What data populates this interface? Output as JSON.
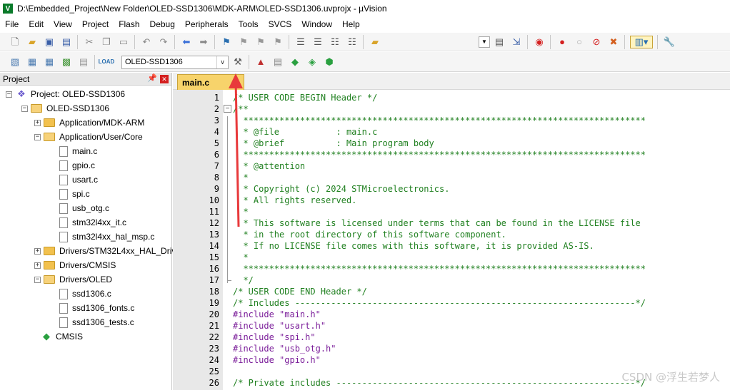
{
  "window": {
    "title": "D:\\Embedded_Project\\New Folder\\OLED-SSD1306\\MDK-ARM\\OLED-SSD1306.uvprojx - µVision",
    "app_icon_letter": "V"
  },
  "menu": [
    "File",
    "Edit",
    "View",
    "Project",
    "Flash",
    "Debug",
    "Peripherals",
    "Tools",
    "SVCS",
    "Window",
    "Help"
  ],
  "toolbar": {
    "target_select_value": "OLED-SSD1306"
  },
  "project_pane": {
    "title": "Project",
    "tree": [
      {
        "label": "Project: OLED-SSD1306",
        "level": 0,
        "toggle": "−",
        "kind": "project"
      },
      {
        "label": "OLED-SSD1306",
        "level": 1,
        "toggle": "−",
        "kind": "folder-open"
      },
      {
        "label": "Application/MDK-ARM",
        "level": 2,
        "toggle": "+",
        "kind": "folder"
      },
      {
        "label": "Application/User/Core",
        "level": 2,
        "toggle": "−",
        "kind": "folder-open"
      },
      {
        "label": "main.c",
        "level": 3,
        "toggle": "",
        "kind": "file"
      },
      {
        "label": "gpio.c",
        "level": 3,
        "toggle": "",
        "kind": "file"
      },
      {
        "label": "usart.c",
        "level": 3,
        "toggle": "",
        "kind": "file"
      },
      {
        "label": "spi.c",
        "level": 3,
        "toggle": "",
        "kind": "file"
      },
      {
        "label": "usb_otg.c",
        "level": 3,
        "toggle": "",
        "kind": "file"
      },
      {
        "label": "stm32l4xx_it.c",
        "level": 3,
        "toggle": "",
        "kind": "file"
      },
      {
        "label": "stm32l4xx_hal_msp.c",
        "level": 3,
        "toggle": "",
        "kind": "file"
      },
      {
        "label": "Drivers/STM32L4xx_HAL_Driv",
        "level": 2,
        "toggle": "+",
        "kind": "folder"
      },
      {
        "label": "Drivers/CMSIS",
        "level": 2,
        "toggle": "+",
        "kind": "folder"
      },
      {
        "label": "Drivers/OLED",
        "level": 2,
        "toggle": "−",
        "kind": "folder-open"
      },
      {
        "label": "ssd1306.c",
        "level": 3,
        "toggle": "",
        "kind": "file"
      },
      {
        "label": "ssd1306_fonts.c",
        "level": 3,
        "toggle": "",
        "kind": "file"
      },
      {
        "label": "ssd1306_tests.c",
        "level": 3,
        "toggle": "",
        "kind": "file"
      },
      {
        "label": "CMSIS",
        "level": 2,
        "toggle": "",
        "kind": "gem"
      }
    ]
  },
  "editor": {
    "active_tab": "main.c",
    "lines": [
      {
        "n": "1",
        "text": "/* USER CODE BEGIN Header */"
      },
      {
        "n": "2",
        "text": "/**"
      },
      {
        "n": "3",
        "text": "  ******************************************************************************"
      },
      {
        "n": "4",
        "text": "  * @file           : main.c"
      },
      {
        "n": "5",
        "text": "  * @brief          : Main program body"
      },
      {
        "n": "6",
        "text": "  ******************************************************************************"
      },
      {
        "n": "7",
        "text": "  * @attention"
      },
      {
        "n": "8",
        "text": "  *"
      },
      {
        "n": "9",
        "text": "  * Copyright (c) 2024 STMicroelectronics."
      },
      {
        "n": "10",
        "text": "  * All rights reserved."
      },
      {
        "n": "11",
        "text": "  *"
      },
      {
        "n": "12",
        "text": "  * This software is licensed under terms that can be found in the LICENSE file"
      },
      {
        "n": "13",
        "text": "  * in the root directory of this software component."
      },
      {
        "n": "14",
        "text": "  * If no LICENSE file comes with this software, it is provided AS-IS."
      },
      {
        "n": "15",
        "text": "  *"
      },
      {
        "n": "16",
        "text": "  ******************************************************************************"
      },
      {
        "n": "17",
        "text": "  */"
      },
      {
        "n": "18",
        "text": "/* USER CODE END Header */"
      },
      {
        "n": "19",
        "text": "/* Includes ------------------------------------------------------------------*/"
      },
      {
        "n": "20",
        "kw": "#include",
        "str": "\"main.h\""
      },
      {
        "n": "21",
        "kw": "#include",
        "str": "\"usart.h\""
      },
      {
        "n": "22",
        "kw": "#include",
        "str": "\"spi.h\""
      },
      {
        "n": "23",
        "kw": "#include",
        "str": "\"usb_otg.h\""
      },
      {
        "n": "24",
        "kw": "#include",
        "str": "\"gpio.h\""
      },
      {
        "n": "25",
        "text": ""
      },
      {
        "n": "26",
        "text": "/* Private includes ----------------------------------------------------------*/"
      }
    ]
  },
  "watermark": "CSDN @浮生若梦人",
  "colors": {
    "comment": "#208020",
    "preprocessor": "#7b1e9a",
    "tab_active": "#f7d36b",
    "annotation_arrow": "#e8393b"
  }
}
